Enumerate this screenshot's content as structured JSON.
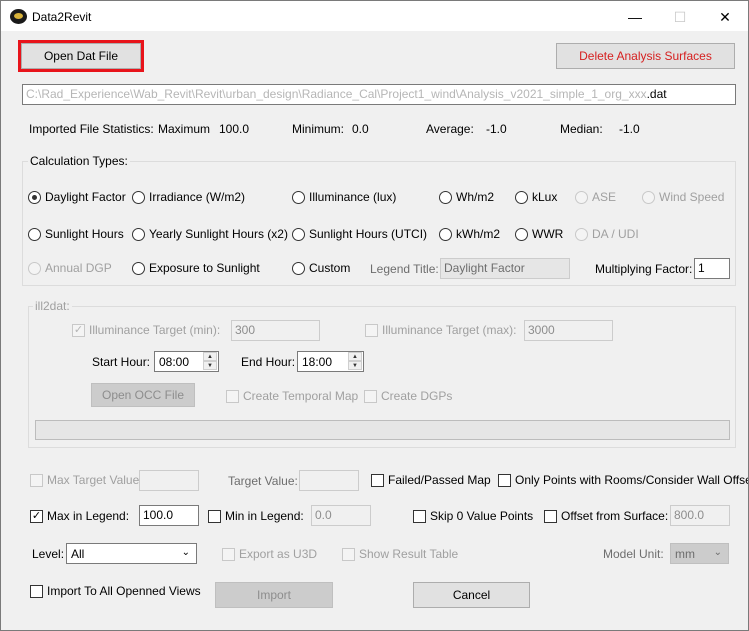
{
  "window": {
    "title": "Data2Revit",
    "controls": {
      "minimize": "—",
      "maximize": "☐",
      "close": "✕"
    }
  },
  "top": {
    "open_dat_label": "Open Dat File",
    "delete_surfaces_label": "Delete Analysis Surfaces",
    "file_path_prefix": "C:\\Rad_Experience\\Wab_Revit\\Revit\\urban_design\\Radiance_Cal\\Project1_wind\\Analysis_v2021_simple_1_org_xxx",
    "file_path_ext": ".dat"
  },
  "stats": {
    "label": "Imported File Statistics:",
    "max_label": "Maximum",
    "max_value": "100.0",
    "min_label": "Minimum:",
    "min_value": "0.0",
    "avg_label": "Average:",
    "avg_value": "-1.0",
    "median_label": "Median:",
    "median_value": "-1.0"
  },
  "calc": {
    "group_label": "Calculation Types:",
    "daylight_factor": "Daylight Factor",
    "irradiance": "Irradiance (W/m2)",
    "illuminance": "Illuminance (lux)",
    "whm2": "Wh/m2",
    "klux": "kLux",
    "ase": "ASE",
    "wind_speed": "Wind Speed",
    "sunlight_hours": "Sunlight Hours",
    "yearly_sunlight": "Yearly Sunlight Hours (x2)",
    "sunlight_utci": "Sunlight Hours (UTCI)",
    "kwhm2": "kWh/m2",
    "wwr": "WWR",
    "da_udi": "DA / UDI",
    "annual_dgp": "Annual DGP",
    "exposure": "Exposure to Sunlight",
    "custom": "Custom",
    "legend_title_label": "Legend Title:",
    "legend_title_value": "Daylight Factor",
    "multiplying_label": "Multiplying Factor:",
    "multiplying_value": "1"
  },
  "ill2dat": {
    "group_label": "ill2dat:",
    "illum_min_label": "Illuminance Target (min):",
    "illum_min_value": "300",
    "illum_max_label": "Illuminance Target (max):",
    "illum_max_value": "3000",
    "start_hour_label": "Start Hour:",
    "start_hour_value": "08:00",
    "end_hour_label": "End Hour:",
    "end_hour_value": "18:00",
    "open_occ_label": "Open OCC File",
    "temporal_map_label": "Create Temporal Map",
    "dgps_label": "Create DGPs"
  },
  "options": {
    "max_target_label": "Max Target Value:",
    "target_value_label": "Target Value:",
    "failed_passed_label": "Failed/Passed Map",
    "only_points_label": "Only Points with Rooms/Consider Wall Offset",
    "max_legend_label": "Max in Legend:",
    "max_legend_value": "100.0",
    "min_legend_label": "Min in Legend:",
    "min_legend_value": "0.0",
    "skip_zero_label": "Skip 0 Value Points",
    "offset_label": "Offset from Surface:",
    "offset_value": "800.0",
    "level_label": "Level:",
    "level_value": "All",
    "export_u3d_label": "Export as U3D",
    "show_table_label": "Show Result Table",
    "model_unit_label": "Model Unit:",
    "model_unit_value": "mm",
    "import_all_label": "Import To All Openned Views",
    "import_label": "Import",
    "cancel_label": "Cancel"
  }
}
